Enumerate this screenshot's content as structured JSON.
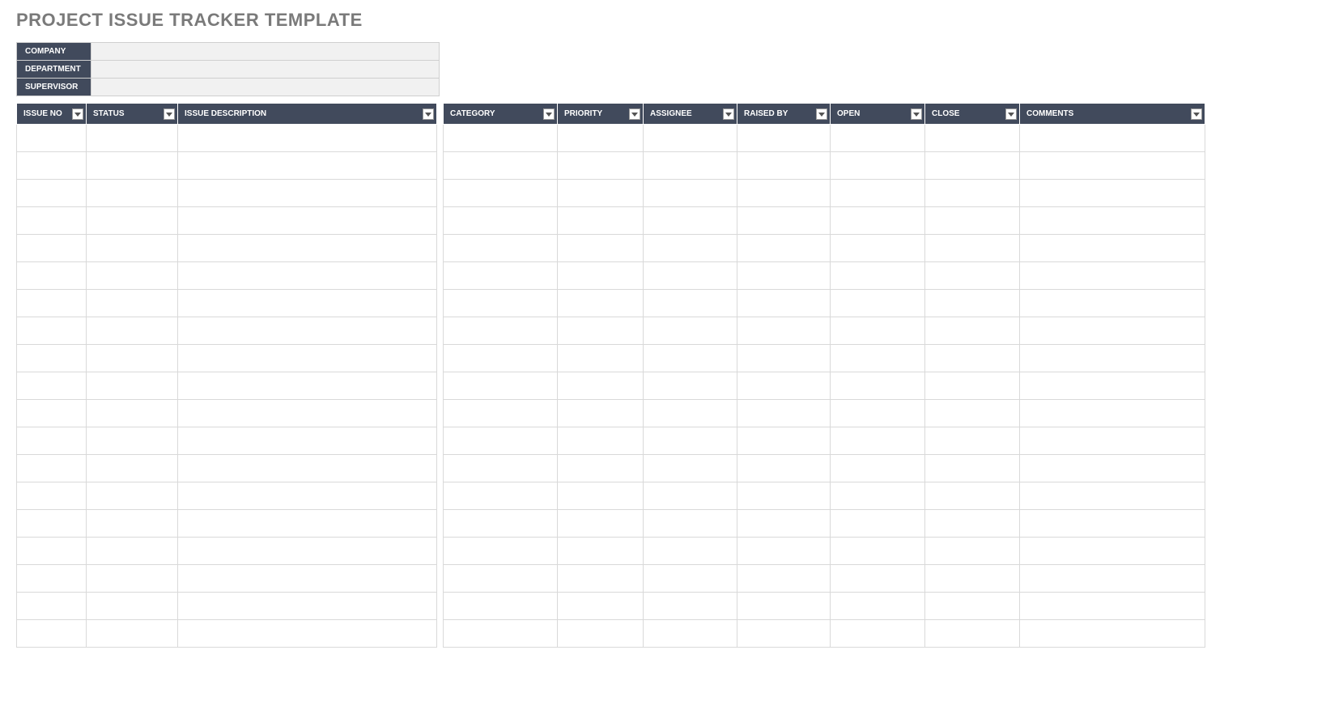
{
  "title": "PROJECT ISSUE TRACKER TEMPLATE",
  "meta": {
    "company": {
      "label": "COMPANY",
      "value": ""
    },
    "department": {
      "label": "DEPARTMENT",
      "value": ""
    },
    "supervisor": {
      "label": "SUPERVISOR",
      "value": ""
    }
  },
  "columns": {
    "issue_no": "ISSUE NO",
    "status": "STATUS",
    "issue_description": "ISSUE DESCRIPTION",
    "category": "CATEGORY",
    "priority": "PRIORITY",
    "assignee": "ASSIGNEE",
    "raised_by": "RAISED BY",
    "open": "OPEN",
    "close": "CLOSE",
    "comments": "COMMENTS"
  },
  "rows": [
    {
      "issue_no": "",
      "status": "",
      "issue_description": "",
      "category": "",
      "priority": "",
      "assignee": "",
      "raised_by": "",
      "open": "",
      "close": "",
      "comments": ""
    },
    {
      "issue_no": "",
      "status": "",
      "issue_description": "",
      "category": "",
      "priority": "",
      "assignee": "",
      "raised_by": "",
      "open": "",
      "close": "",
      "comments": ""
    },
    {
      "issue_no": "",
      "status": "",
      "issue_description": "",
      "category": "",
      "priority": "",
      "assignee": "",
      "raised_by": "",
      "open": "",
      "close": "",
      "comments": ""
    },
    {
      "issue_no": "",
      "status": "",
      "issue_description": "",
      "category": "",
      "priority": "",
      "assignee": "",
      "raised_by": "",
      "open": "",
      "close": "",
      "comments": ""
    },
    {
      "issue_no": "",
      "status": "",
      "issue_description": "",
      "category": "",
      "priority": "",
      "assignee": "",
      "raised_by": "",
      "open": "",
      "close": "",
      "comments": ""
    },
    {
      "issue_no": "",
      "status": "",
      "issue_description": "",
      "category": "",
      "priority": "",
      "assignee": "",
      "raised_by": "",
      "open": "",
      "close": "",
      "comments": ""
    },
    {
      "issue_no": "",
      "status": "",
      "issue_description": "",
      "category": "",
      "priority": "",
      "assignee": "",
      "raised_by": "",
      "open": "",
      "close": "",
      "comments": ""
    },
    {
      "issue_no": "",
      "status": "",
      "issue_description": "",
      "category": "",
      "priority": "",
      "assignee": "",
      "raised_by": "",
      "open": "",
      "close": "",
      "comments": ""
    },
    {
      "issue_no": "",
      "status": "",
      "issue_description": "",
      "category": "",
      "priority": "",
      "assignee": "",
      "raised_by": "",
      "open": "",
      "close": "",
      "comments": ""
    },
    {
      "issue_no": "",
      "status": "",
      "issue_description": "",
      "category": "",
      "priority": "",
      "assignee": "",
      "raised_by": "",
      "open": "",
      "close": "",
      "comments": ""
    },
    {
      "issue_no": "",
      "status": "",
      "issue_description": "",
      "category": "",
      "priority": "",
      "assignee": "",
      "raised_by": "",
      "open": "",
      "close": "",
      "comments": ""
    },
    {
      "issue_no": "",
      "status": "",
      "issue_description": "",
      "category": "",
      "priority": "",
      "assignee": "",
      "raised_by": "",
      "open": "",
      "close": "",
      "comments": ""
    },
    {
      "issue_no": "",
      "status": "",
      "issue_description": "",
      "category": "",
      "priority": "",
      "assignee": "",
      "raised_by": "",
      "open": "",
      "close": "",
      "comments": ""
    },
    {
      "issue_no": "",
      "status": "",
      "issue_description": "",
      "category": "",
      "priority": "",
      "assignee": "",
      "raised_by": "",
      "open": "",
      "close": "",
      "comments": ""
    },
    {
      "issue_no": "",
      "status": "",
      "issue_description": "",
      "category": "",
      "priority": "",
      "assignee": "",
      "raised_by": "",
      "open": "",
      "close": "",
      "comments": ""
    },
    {
      "issue_no": "",
      "status": "",
      "issue_description": "",
      "category": "",
      "priority": "",
      "assignee": "",
      "raised_by": "",
      "open": "",
      "close": "",
      "comments": ""
    },
    {
      "issue_no": "",
      "status": "",
      "issue_description": "",
      "category": "",
      "priority": "",
      "assignee": "",
      "raised_by": "",
      "open": "",
      "close": "",
      "comments": ""
    },
    {
      "issue_no": "",
      "status": "",
      "issue_description": "",
      "category": "",
      "priority": "",
      "assignee": "",
      "raised_by": "",
      "open": "",
      "close": "",
      "comments": ""
    },
    {
      "issue_no": "",
      "status": "",
      "issue_description": "",
      "category": "",
      "priority": "",
      "assignee": "",
      "raised_by": "",
      "open": "",
      "close": "",
      "comments": ""
    }
  ]
}
